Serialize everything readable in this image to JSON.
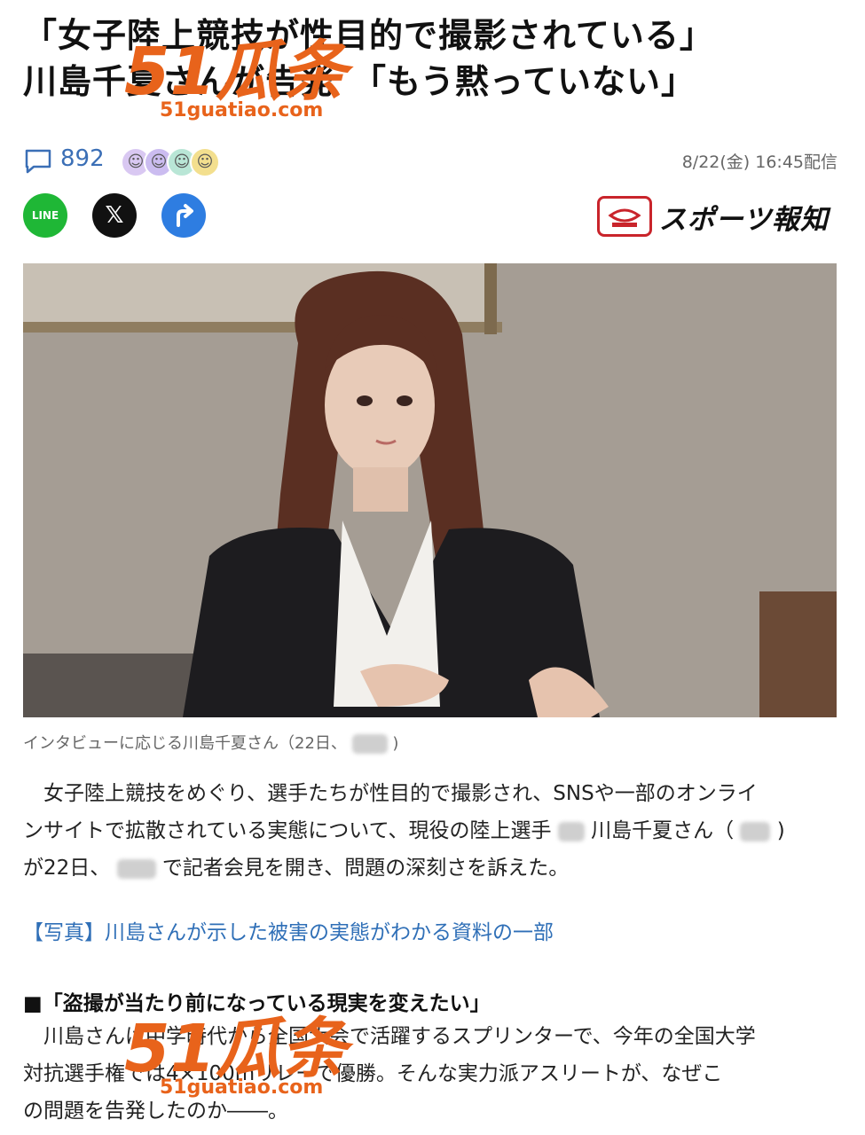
{
  "article": {
    "headline_line1": "「女子陸上競技が性目的で撮影されている」",
    "headline_line2": "川島千夏さんが告発　「もう黙っていない」",
    "comment_count": "892",
    "timestamp": "8/22(金) 16:45配信",
    "publisher": "スポーツ報知",
    "photo_caption": "インタビューに応じる川島千夏さん（22日、",
    "body_paragraph_1_a": "　女子陸上競技をめぐり、選手たちが性目的で撮影され、SNSや一部のオンライ",
    "body_paragraph_1_b": "ンサイトで拡散されている実態について、現役の陸上選手",
    "body_paragraph_1_c": "川島千夏さん（",
    "body_paragraph_1_d": "が22日、",
    "body_paragraph_1_e": "で記者会見を開き、問題の深刻さを訴えた。",
    "related_link": "【写真】川島さんが示した被害の実態がわかる資料の一部",
    "section_heading": "■「盗撮が当たり前になっている現実を変えたい」",
    "body_paragraph_2_a": "　川島さんは中学時代から全国大会で活躍するスプリンターで、今年の全国大学",
    "body_paragraph_2_b": "対抗選手権では4×100mリレーで優勝。そんな実力派アスリートが、なぜこ",
    "body_paragraph_2_c": "の問題を告発したのか――。"
  },
  "share": {
    "line_label": "LINE",
    "x_label": "𝕏"
  },
  "icons": {
    "comment": "comment-icon",
    "line": "line-icon",
    "x": "x-icon",
    "share": "share-icon",
    "publisher_logo": "publisher-logo-icon"
  },
  "watermark": {
    "number": "51瓜条",
    "url": "51guatiao.com"
  },
  "colors": {
    "link": "#2f6fb7",
    "line_green": "#1fb736",
    "share_blue": "#2e7de1",
    "watermark_orange": "#e8631b",
    "publisher_red": "#c9242b"
  }
}
